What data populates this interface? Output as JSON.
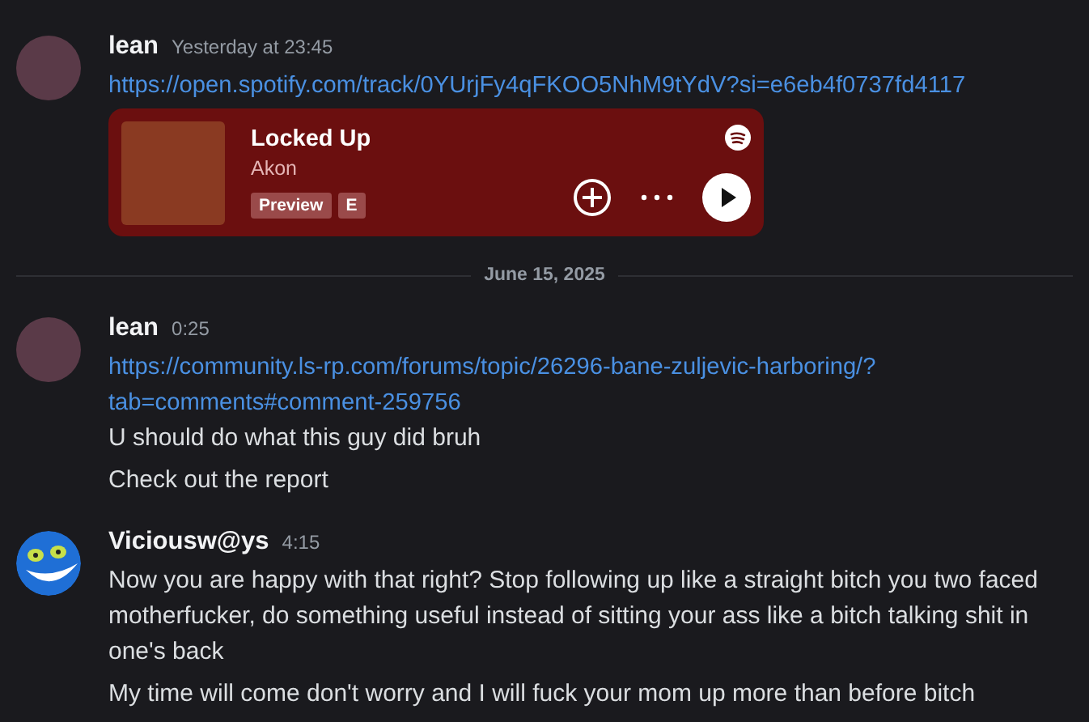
{
  "messages": [
    {
      "author": "lean",
      "avatar": {
        "kind": "photo"
      },
      "time": "Yesterday at 23:45",
      "content": [
        {
          "kind": "link",
          "text": "https://open.spotify.com/track/0YUrjFy4qFKOO5NhM9tYdV?si=e6eb4f0737fd4117"
        },
        {
          "kind": "embed",
          "title": "Locked Up",
          "artist": "Akon",
          "badges": [
            "Preview",
            "E"
          ]
        }
      ]
    },
    {
      "kind": "divider",
      "date": "June 15, 2025"
    },
    {
      "author": "lean",
      "avatar": {
        "kind": "photo"
      },
      "time": "0:25",
      "content": [
        {
          "kind": "link",
          "text": "https://community.ls-rp.com/forums/topic/26296-bane-zuljevic-harboring/?tab=comments#comment-259756"
        },
        {
          "kind": "text",
          "text": "U should do what this guy did bruh"
        },
        {
          "kind": "text",
          "text": "Check out the report"
        }
      ]
    },
    {
      "author": "Viciousw@ys",
      "avatar": {
        "kind": "smiley"
      },
      "time": "4:15",
      "content": [
        {
          "kind": "text",
          "text": "Now you are happy with that right? Stop following up like a straight bitch you two faced motherfucker, do something useful instead of sitting your ass like a bitch talking shit in one's back"
        },
        {
          "kind": "text",
          "text": "My time will come don't worry and I will fuck your mom up more than before bitch"
        }
      ]
    }
  ]
}
